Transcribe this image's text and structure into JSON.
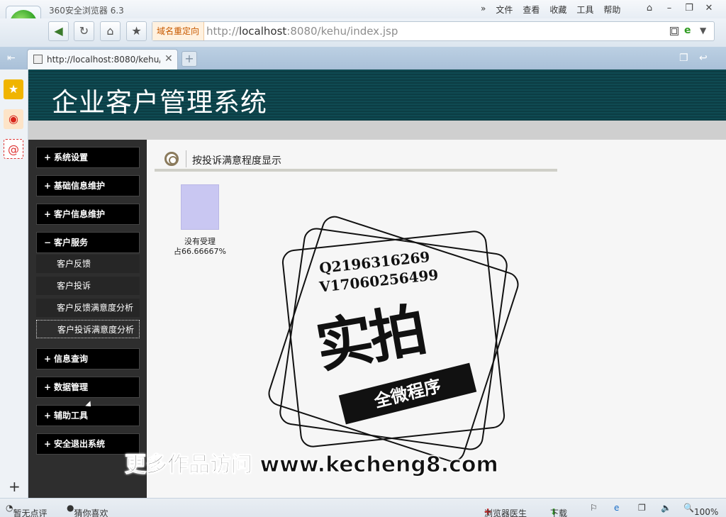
{
  "browser": {
    "app_title": "360安全浏览器 6.3",
    "menu": [
      "»",
      "文件",
      "查看",
      "收藏",
      "工具",
      "帮助"
    ],
    "address_tag": "域名重定向",
    "url_prefix": "http://",
    "url_host": "localhost",
    "url_rest": ":8080/kehu/index.jsp",
    "tab_title": "http://localhost:8080/kehu/i",
    "status_left1": "暂无点评",
    "status_left2": "猜你喜欢",
    "status_doctor": "浏览器医生",
    "status_download": "下载",
    "zoom": "100%"
  },
  "page": {
    "system_title": "企业客户管理系统",
    "section_title": "按投诉满意程度显示",
    "nav": [
      {
        "sign": "+",
        "label": "系统设置"
      },
      {
        "sign": "+",
        "label": "基础信息维护"
      },
      {
        "sign": "+",
        "label": "客户信息维护"
      },
      {
        "sign": "−",
        "label": "客户服务"
      },
      {
        "sign": "+",
        "label": "信息查询"
      },
      {
        "sign": "+",
        "label": "数据管理"
      },
      {
        "sign": "+",
        "label": "辅助工具"
      },
      {
        "sign": "+",
        "label": "安全退出系统"
      }
    ],
    "sub": [
      "客户反馈",
      "客户投诉",
      "客户反馈满意度分析",
      "客户投诉满意度分析"
    ]
  },
  "chart_data": {
    "type": "bar",
    "categories": [
      "没有受理"
    ],
    "values": [
      66.66667
    ],
    "data_labels": [
      "没有受理",
      "占66.66667%"
    ]
  },
  "watermark": {
    "line1": "Q2196316269",
    "line2": "V17060256499",
    "big": "实拍",
    "ribbon": "全微程序",
    "footer": "更多作品访问 www.kecheng8.com"
  }
}
